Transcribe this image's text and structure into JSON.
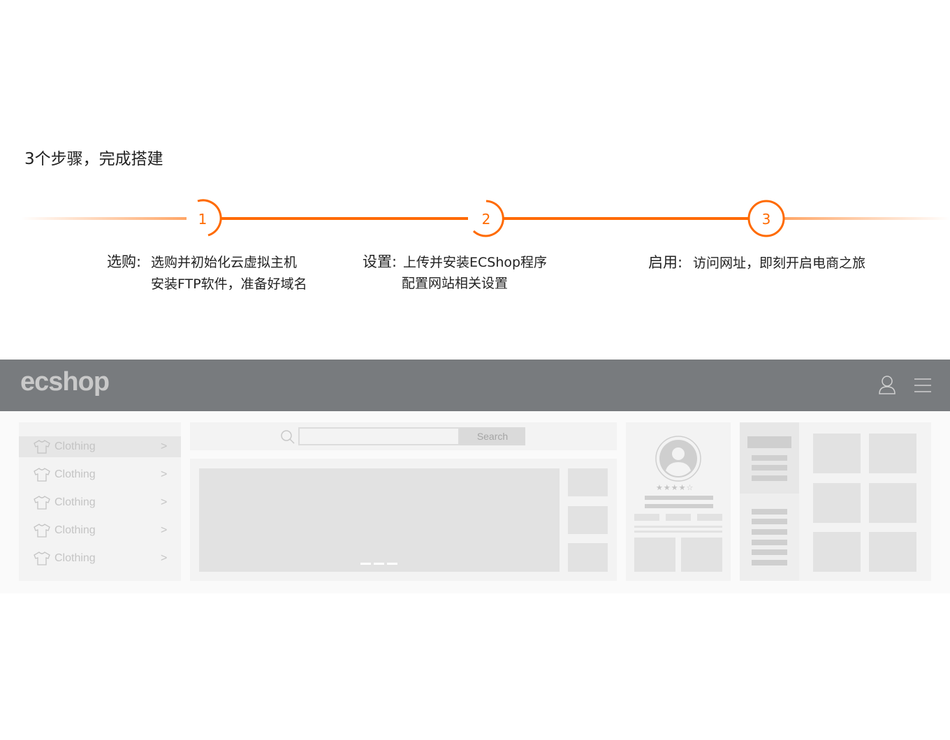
{
  "heading": "3个步骤，完成搭建",
  "accent": "#ff6a00",
  "steps": [
    {
      "number": "1",
      "title": "选购:",
      "lines": [
        "选购并初始化云虚拟主机",
        "安装FTP软件，准备好域名"
      ]
    },
    {
      "number": "2",
      "title": "设置:",
      "lines": [
        "上传并安装ECShop程序",
        "配置网站相关设置"
      ]
    },
    {
      "number": "3",
      "title": "启用:",
      "lines": [
        "访问网址，即刻开启电商之旅"
      ]
    }
  ],
  "mockup": {
    "logo": "ecshop",
    "header_icons": [
      "user-icon",
      "menu-icon"
    ],
    "categories": [
      {
        "label": "Clothing",
        "chevron": ">"
      },
      {
        "label": "Clothing",
        "chevron": ">"
      },
      {
        "label": "Clothing",
        "chevron": ">"
      },
      {
        "label": "Clothing",
        "chevron": ">"
      },
      {
        "label": "Clothing",
        "chevron": ">"
      }
    ],
    "search_button": "Search",
    "rating": 4,
    "rating_max": 5
  }
}
